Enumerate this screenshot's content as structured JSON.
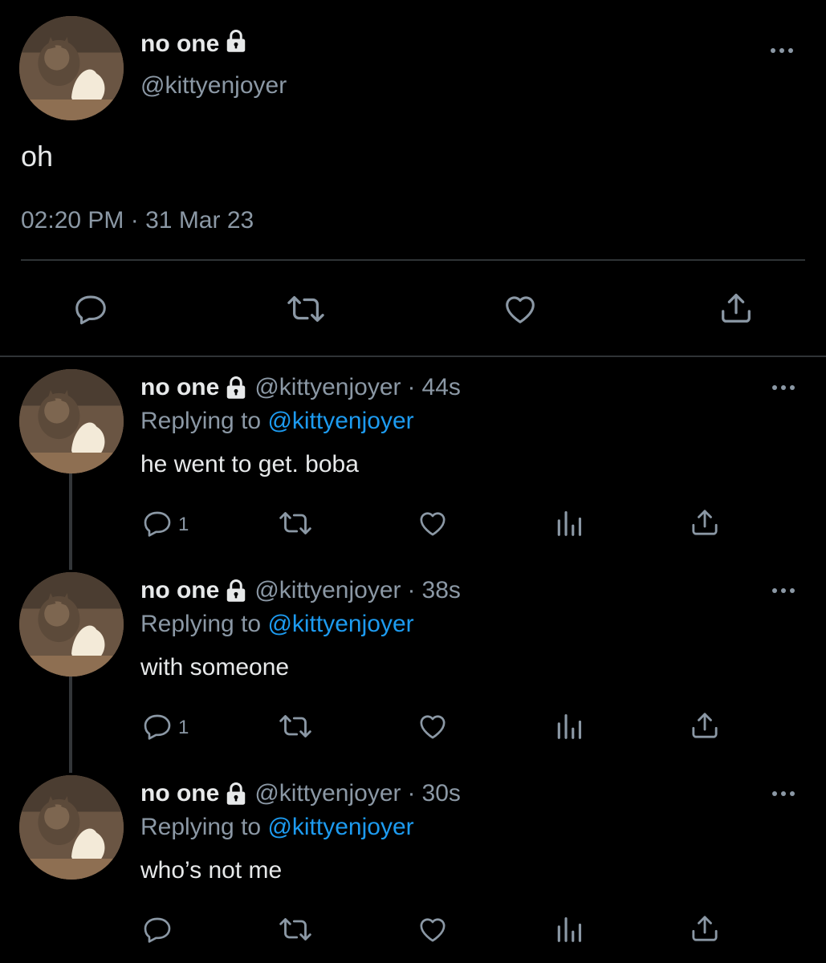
{
  "main_tweet": {
    "display_name": "no one",
    "handle": "@kittyenjoyer",
    "text": "oh",
    "time": "02:20 PM",
    "date": "31 Mar 23",
    "separator": "·"
  },
  "replies": [
    {
      "display_name": "no one",
      "handle": "@kittyenjoyer",
      "age": "44s",
      "replying_prefix": "Replying to",
      "replying_to": "@kittyenjoyer",
      "text": "he went to get. boba",
      "reply_count": "1"
    },
    {
      "display_name": "no one",
      "handle": "@kittyenjoyer",
      "age": "38s",
      "replying_prefix": "Replying to",
      "replying_to": "@kittyenjoyer",
      "text": "with someone",
      "reply_count": "1"
    },
    {
      "display_name": "no one",
      "handle": "@kittyenjoyer",
      "age": "30s",
      "replying_prefix": "Replying to",
      "replying_to": "@kittyenjoyer",
      "text": "who’s not me",
      "reply_count": ""
    }
  ],
  "colors": {
    "background": "#000000",
    "text_primary": "#e7e9ea",
    "text_secondary": "#8b98a5",
    "mention": "#1d9bf0",
    "divider": "#2f3336"
  },
  "icons": {
    "lock": "lock-icon",
    "reply": "reply-icon",
    "retweet": "retweet-icon",
    "like": "heart-icon",
    "views": "analytics-icon",
    "share": "share-icon",
    "more": "more-icon"
  }
}
